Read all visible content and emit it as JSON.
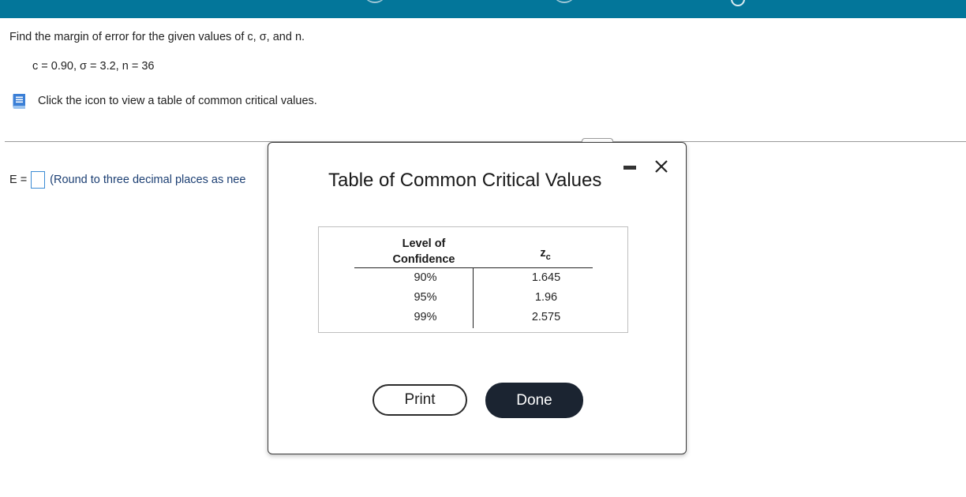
{
  "header": {
    "bar_color": "#03769a"
  },
  "question": {
    "text": "Find the margin of error for the given values of c, σ, and n.",
    "given": "c = 0.90, σ = 3.2, n = 36"
  },
  "hint": {
    "icon": "book-icon",
    "text": "Click the icon to view a table of common critical values."
  },
  "answer": {
    "label": "E =",
    "value": "",
    "note": "(Round to three decimal places as nee"
  },
  "modal": {
    "title": "Table of Common Critical Values",
    "minimize_icon": "minimize-icon",
    "close_icon": "close-icon",
    "table": {
      "headers": {
        "level_line1": "Level of",
        "level_line2": "Confidence",
        "z": "z",
        "z_sub": "c"
      },
      "rows": [
        {
          "level": "90%",
          "z": "1.645"
        },
        {
          "level": "95%",
          "z": "1.96"
        },
        {
          "level": "99%",
          "z": "2.575"
        }
      ]
    },
    "print_label": "Print",
    "done_label": "Done",
    "done_color": "#1b2431"
  }
}
